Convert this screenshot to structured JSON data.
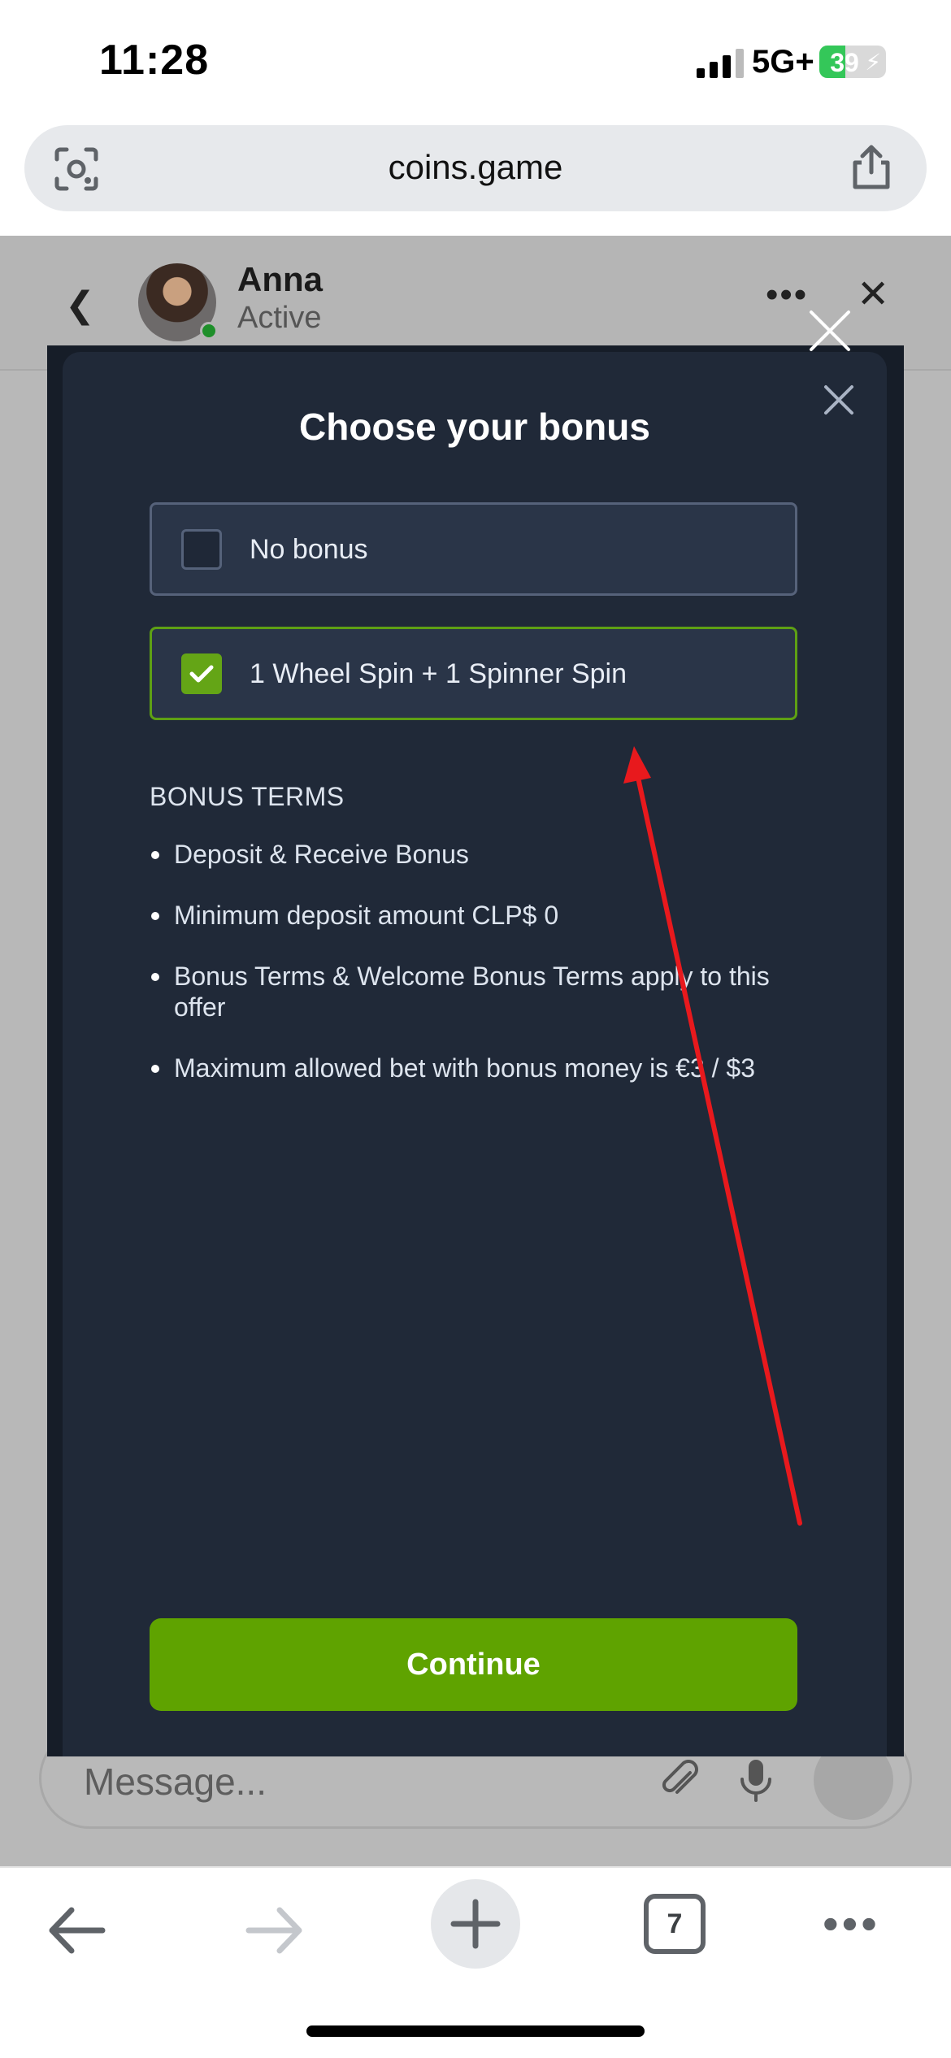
{
  "status_bar": {
    "time": "11:28",
    "network": "5G+",
    "battery_percent": "39",
    "battery_level": 0.39,
    "icons": [
      "signal-bars-icon",
      "battery-charging-icon"
    ]
  },
  "browser": {
    "url": "coins.game",
    "icons": [
      "lens-icon",
      "share-icon"
    ]
  },
  "chat": {
    "agent_name": "Anna",
    "agent_status": "Active",
    "more_label": "•••",
    "message_placeholder": "Message...",
    "icons": [
      "chevron-left-icon",
      "more-icon",
      "close-icon",
      "paperclip-icon",
      "microphone-icon",
      "send-icon"
    ]
  },
  "modal": {
    "title": "Choose your bonus",
    "options": [
      {
        "label": "No bonus",
        "checked": false
      },
      {
        "label": "1 Wheel Spin + 1 Spinner Spin",
        "checked": true
      }
    ],
    "terms_title": "BONUS TERMS",
    "terms": [
      "Deposit & Receive Bonus",
      "Minimum deposit amount CLP$ 0",
      "Bonus Terms & Welcome Bonus Terms apply to this offer",
      "Maximum allowed bet with bonus money is €3 / $3"
    ],
    "continue_label": "Continue",
    "accent_color": "#5fa300",
    "annotation_arrow_color": "#e8191d"
  },
  "toolbar": {
    "tab_count": "7",
    "more_label": "•••",
    "icons": [
      "arrow-left-icon",
      "arrow-right-icon",
      "plus-icon",
      "tabs-icon",
      "more-icon"
    ]
  }
}
